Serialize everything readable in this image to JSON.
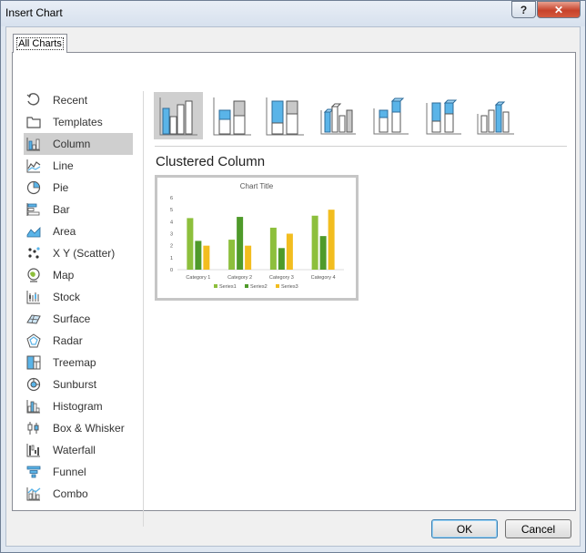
{
  "window": {
    "title": "Insert Chart",
    "help_label": "?",
    "close_label": "✕"
  },
  "tab": {
    "label": "All Charts"
  },
  "categories": [
    {
      "label": "Recent",
      "icon": "recent-icon"
    },
    {
      "label": "Templates",
      "icon": "folder-icon"
    },
    {
      "label": "Column",
      "icon": "column-chart-icon",
      "selected": true
    },
    {
      "label": "Line",
      "icon": "line-chart-icon"
    },
    {
      "label": "Pie",
      "icon": "pie-chart-icon"
    },
    {
      "label": "Bar",
      "icon": "bar-chart-icon"
    },
    {
      "label": "Area",
      "icon": "area-chart-icon"
    },
    {
      "label": "X Y (Scatter)",
      "icon": "scatter-chart-icon"
    },
    {
      "label": "Map",
      "icon": "map-chart-icon"
    },
    {
      "label": "Stock",
      "icon": "stock-chart-icon"
    },
    {
      "label": "Surface",
      "icon": "surface-chart-icon"
    },
    {
      "label": "Radar",
      "icon": "radar-chart-icon"
    },
    {
      "label": "Treemap",
      "icon": "treemap-chart-icon"
    },
    {
      "label": "Sunburst",
      "icon": "sunburst-chart-icon"
    },
    {
      "label": "Histogram",
      "icon": "histogram-chart-icon"
    },
    {
      "label": "Box & Whisker",
      "icon": "box-whisker-chart-icon"
    },
    {
      "label": "Waterfall",
      "icon": "waterfall-chart-icon"
    },
    {
      "label": "Funnel",
      "icon": "funnel-chart-icon"
    },
    {
      "label": "Combo",
      "icon": "combo-chart-icon"
    }
  ],
  "subtypes": [
    {
      "icon": "clustered-column-icon",
      "selected": true
    },
    {
      "icon": "stacked-column-icon"
    },
    {
      "icon": "100-stacked-column-icon"
    },
    {
      "icon": "3d-clustered-column-icon"
    },
    {
      "icon": "3d-stacked-column-icon"
    },
    {
      "icon": "3d-100-stacked-column-icon"
    },
    {
      "icon": "3d-column-icon"
    }
  ],
  "selected_subtype_title": "Clustered Column",
  "preview_chart": {
    "chart_data": {
      "type": "bar",
      "title": "Chart Title",
      "categories": [
        "Category 1",
        "Category 2",
        "Category 3",
        "Category 4"
      ],
      "series": [
        {
          "name": "Series1",
          "values": [
            4.3,
            2.5,
            3.5,
            4.5
          ],
          "color": "#8dbf3c"
        },
        {
          "name": "Series2",
          "values": [
            2.4,
            4.4,
            1.8,
            2.8
          ],
          "color": "#4f9a2a"
        },
        {
          "name": "Series3",
          "values": [
            2,
            2,
            3,
            5
          ],
          "color": "#f2bd1f"
        }
      ],
      "ylim": [
        0,
        6
      ],
      "yticks": [
        "0",
        "1",
        "2",
        "3",
        "4",
        "5",
        "6"
      ],
      "legend": "bottom",
      "grid": false
    }
  },
  "buttons": {
    "ok": "OK",
    "cancel": "Cancel"
  },
  "colors": {
    "accent_blue": "#5ab4e8",
    "selection_gray": "#cfcfcf"
  }
}
